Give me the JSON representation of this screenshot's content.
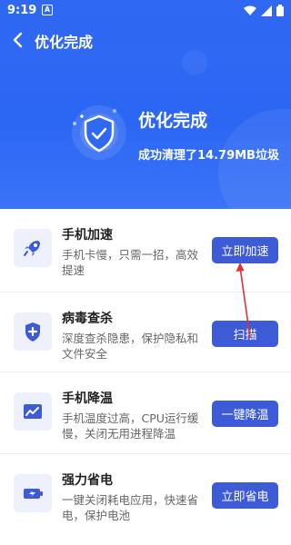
{
  "status_bar": {
    "time": "9:19",
    "notification_letter": "A"
  },
  "header": {
    "title": "优化完成",
    "result_title": "优化完成",
    "result_subtitle": "成功清理了14.79MB垃圾",
    "colors": {
      "background": "#2f68f2",
      "accent": "#3e5bd7",
      "arrow": "#e23030"
    }
  },
  "items": [
    {
      "title": "手机加速",
      "desc": "手机卡慢，只需一招，高效提速",
      "button": "立即加速",
      "icon": "rocket-icon"
    },
    {
      "title": "病毒查杀",
      "desc": "深度查杀隐患，保护隐私和文件安全",
      "button": "扫描",
      "icon": "shield-plus-icon"
    },
    {
      "title": "手机降温",
      "desc": "手机温度过高，CPU运行缓慢，关闭无用进程降温",
      "button": "一键降温",
      "icon": "chart-line-icon"
    },
    {
      "title": "强力省电",
      "desc": "一键关闭耗电应用，快速省电，保护电池",
      "button": "立即省电",
      "icon": "battery-icon"
    }
  ]
}
